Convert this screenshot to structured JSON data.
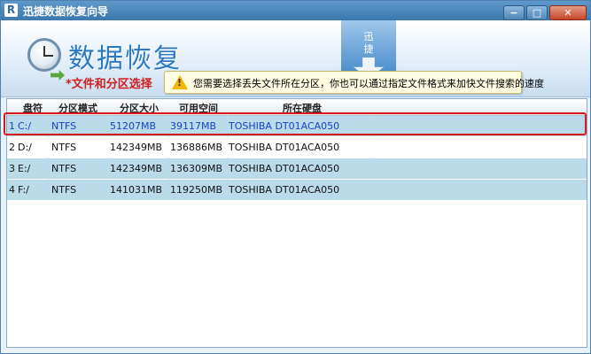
{
  "window": {
    "app_icon": "R",
    "title": "迅捷数据恢复向导",
    "minimize": "−",
    "maximize": "□",
    "close": "✕"
  },
  "banner": {
    "title": "数据恢复",
    "section_label": "*文件和分区选择",
    "brand_text": "迅捷",
    "tip": "您需要选择丢失文件所在分区，你也可以通过指定文件格式来加快文件搜索的速度"
  },
  "table": {
    "columns": [
      "盘符",
      "分区模式",
      "分区大小",
      "可用空间",
      "所在硬盘"
    ],
    "rows": [
      {
        "index": "1",
        "drive": "C:/",
        "mode": "NTFS",
        "size": "51207MB",
        "free": "39117MB",
        "disk": "TOSHIBA DT01ACA050"
      },
      {
        "index": "2",
        "drive": "D:/",
        "mode": "NTFS",
        "size": "142349MB",
        "free": "136886MB",
        "disk": "TOSHIBA DT01ACA050"
      },
      {
        "index": "3",
        "drive": "E:/",
        "mode": "NTFS",
        "size": "142349MB",
        "free": "136309MB",
        "disk": "TOSHIBA DT01ACA050"
      },
      {
        "index": "4",
        "drive": "F:/",
        "mode": "NTFS",
        "size": "141031MB",
        "free": "119250MB",
        "disk": "TOSHIBA DT01ACA050"
      }
    ]
  },
  "colors": {
    "title_blue": "#2c79c6",
    "label_red": "#d11d1d",
    "row_highlight": "#b9dbea",
    "selection_outline": "#d8181f"
  }
}
